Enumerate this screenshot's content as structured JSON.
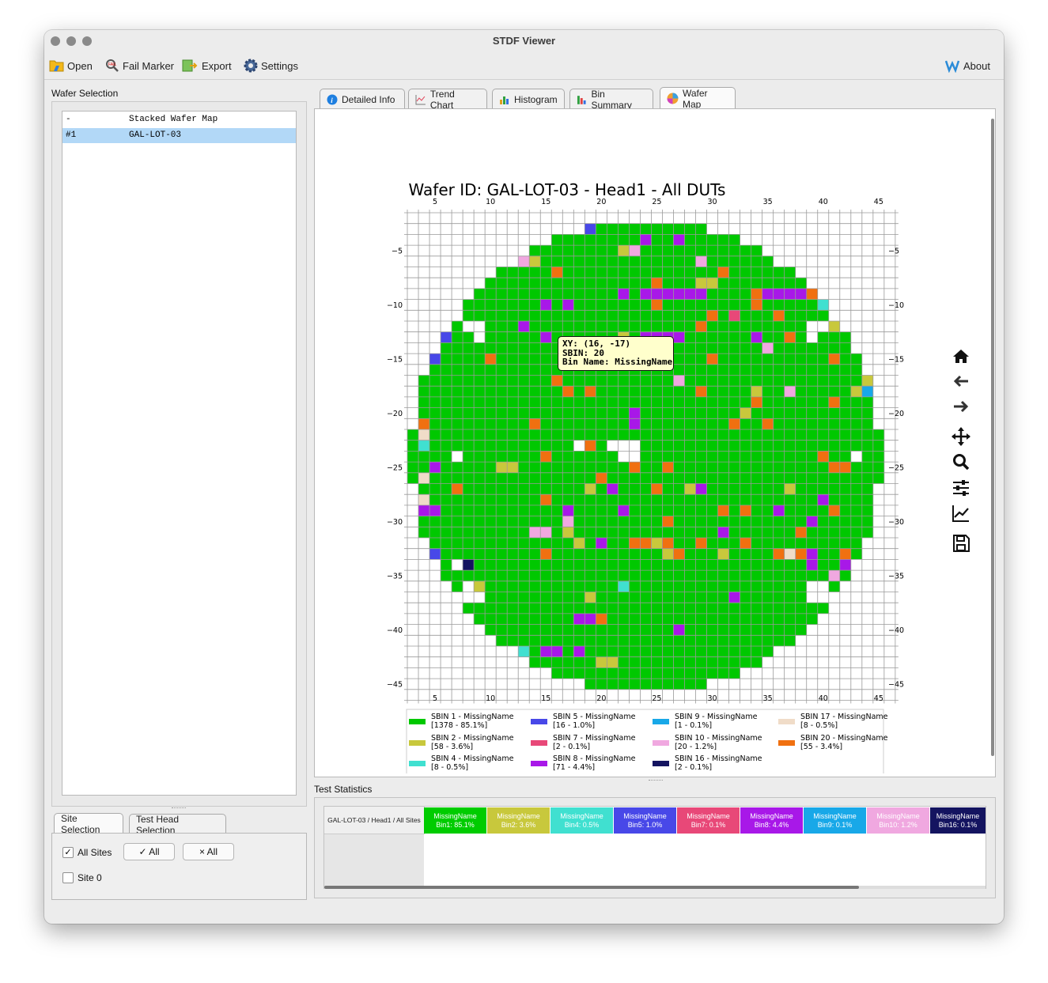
{
  "window": {
    "title": "STDF Viewer"
  },
  "toolbar": {
    "open": "Open",
    "fail_marker": "Fail Marker",
    "export": "Export",
    "settings": "Settings",
    "about": "About"
  },
  "wafer_selection": {
    "title": "Wafer Selection",
    "rows": [
      {
        "id": "-",
        "name": "Stacked Wafer Map"
      },
      {
        "id": "#1",
        "name": "GAL-LOT-03"
      }
    ]
  },
  "bottom_tabs": {
    "site": "Site Selection",
    "head": "Test Head Selection"
  },
  "site_selection": {
    "all_sites": "All Sites",
    "check_all": "✓ All",
    "clear_all": "× All",
    "site0": "Site 0"
  },
  "tabs": [
    "Detailed Info",
    "Trend Chart",
    "Histogram",
    "Bin Summary",
    "Wafer Map"
  ],
  "tooltip": {
    "line1": "XY: (16, -17)",
    "line2": "SBIN: 20",
    "line3": "Bin Name: MissingName"
  },
  "test_statistics": {
    "title": "Test Statistics",
    "row_label": "GAL-LOT-03 / Head1 / All Sites",
    "bins": [
      {
        "name": "MissingName",
        "value": "Bin1: 85.1%",
        "color": "#00cc00"
      },
      {
        "name": "MissingName",
        "value": "Bin2: 3.6%",
        "color": "#c8c83c"
      },
      {
        "name": "MissingName",
        "value": "Bin4: 0.5%",
        "color": "#40e0d0"
      },
      {
        "name": "MissingName",
        "value": "Bin5: 1.0%",
        "color": "#4848e8"
      },
      {
        "name": "MissingName",
        "value": "Bin7: 0.1%",
        "color": "#e84878"
      },
      {
        "name": "MissingName",
        "value": "Bin8: 4.4%",
        "color": "#a818e8"
      },
      {
        "name": "MissingName",
        "value": "Bin9: 0.1%",
        "color": "#18a8e8"
      },
      {
        "name": "MissingName",
        "value": "Bin10: 1.2%",
        "color": "#f0a8e0"
      },
      {
        "name": "MissingName",
        "value": "Bin16: 0.1%",
        "color": "#141460"
      }
    ]
  },
  "chart_data": {
    "type": "heatmap",
    "title": "Wafer ID: GAL-LOT-03 - Head1 - All DUTs",
    "x_ticks": [
      5,
      10,
      15,
      20,
      25,
      30,
      35,
      40,
      45
    ],
    "y_ticks": [
      -5,
      -10,
      -15,
      -20,
      -25,
      -30,
      -35,
      -40,
      -45
    ],
    "xlim": [
      3,
      46
    ],
    "ylim": [
      -46,
      -2
    ],
    "grid": true,
    "center": [
      24,
      -24
    ],
    "radius": 21.2,
    "default_bin": 1,
    "dies": [
      [
        19,
        -3,
        5
      ],
      [
        30,
        -3,
        2
      ],
      [
        24,
        -4,
        8
      ],
      [
        27,
        -4,
        8
      ],
      [
        34,
        -4,
        20
      ],
      [
        35,
        -4,
        2
      ],
      [
        22,
        -5,
        2
      ],
      [
        23,
        -5,
        10
      ],
      [
        13,
        -6,
        10
      ],
      [
        14,
        -6,
        2
      ],
      [
        29,
        -6,
        10
      ],
      [
        16,
        -7,
        20
      ],
      [
        31,
        -7,
        20
      ],
      [
        25,
        -8,
        20
      ],
      [
        29,
        -8,
        2
      ],
      [
        30,
        -8,
        2
      ],
      [
        22,
        -9,
        8
      ],
      [
        24,
        -9,
        8
      ],
      [
        25,
        -9,
        8
      ],
      [
        26,
        -9,
        8
      ],
      [
        27,
        -9,
        8
      ],
      [
        28,
        -9,
        8
      ],
      [
        29,
        -9,
        8
      ],
      [
        34,
        -9,
        20
      ],
      [
        35,
        -9,
        8
      ],
      [
        36,
        -9,
        8
      ],
      [
        37,
        -9,
        8
      ],
      [
        38,
        -9,
        8
      ],
      [
        39,
        -9,
        20
      ],
      [
        15,
        -10,
        8
      ],
      [
        17,
        -10,
        8
      ],
      [
        25,
        -10,
        20
      ],
      [
        34,
        -10,
        20
      ],
      [
        40,
        -10,
        4
      ],
      [
        30,
        -11,
        20
      ],
      [
        32,
        -11,
        7
      ],
      [
        36,
        -11,
        20
      ],
      [
        8,
        -12,
        2
      ],
      [
        13,
        -12,
        8
      ],
      [
        29,
        -12,
        20
      ],
      [
        41,
        -12,
        2
      ],
      [
        6,
        -13,
        5
      ],
      [
        15,
        -13,
        8
      ],
      [
        22,
        -13,
        2
      ],
      [
        24,
        -13,
        8
      ],
      [
        25,
        -13,
        8
      ],
      [
        26,
        -13,
        8
      ],
      [
        27,
        -13,
        8
      ],
      [
        34,
        -13,
        8
      ],
      [
        37,
        -13,
        20
      ],
      [
        43,
        -13,
        5
      ],
      [
        35,
        -14,
        10
      ],
      [
        5,
        -15,
        5
      ],
      [
        10,
        -15,
        20
      ],
      [
        30,
        -15,
        20
      ],
      [
        41,
        -15,
        20
      ],
      [
        44,
        -15,
        5
      ],
      [
        44,
        -16,
        2
      ],
      [
        16,
        -17,
        20
      ],
      [
        27,
        -17,
        10
      ],
      [
        44,
        -17,
        2
      ],
      [
        17,
        -18,
        20
      ],
      [
        19,
        -18,
        20
      ],
      [
        29,
        -18,
        20
      ],
      [
        34,
        -18,
        2
      ],
      [
        37,
        -18,
        10
      ],
      [
        43,
        -18,
        2
      ],
      [
        44,
        -18,
        9
      ],
      [
        34,
        -19,
        20
      ],
      [
        41,
        -19,
        20
      ],
      [
        23,
        -20,
        8
      ],
      [
        33,
        -20,
        2
      ],
      [
        4,
        -21,
        20
      ],
      [
        14,
        -21,
        20
      ],
      [
        23,
        -21,
        8
      ],
      [
        32,
        -21,
        20
      ],
      [
        35,
        -21,
        20
      ],
      [
        4,
        -22,
        17
      ],
      [
        4,
        -23,
        4
      ],
      [
        19,
        -23,
        20
      ],
      [
        15,
        -24,
        20
      ],
      [
        40,
        -24,
        20
      ],
      [
        5,
        -25,
        8
      ],
      [
        11,
        -25,
        2
      ],
      [
        12,
        -25,
        2
      ],
      [
        23,
        -25,
        20
      ],
      [
        26,
        -25,
        20
      ],
      [
        41,
        -25,
        20
      ],
      [
        42,
        -25,
        20
      ],
      [
        4,
        -26,
        17
      ],
      [
        20,
        -26,
        20
      ],
      [
        7,
        -27,
        20
      ],
      [
        19,
        -27,
        2
      ],
      [
        21,
        -27,
        8
      ],
      [
        25,
        -27,
        20
      ],
      [
        28,
        -27,
        2
      ],
      [
        29,
        -27,
        8
      ],
      [
        37,
        -27,
        2
      ],
      [
        15,
        -28,
        20
      ],
      [
        4,
        -28,
        17
      ],
      [
        40,
        -28,
        8
      ],
      [
        4,
        -29,
        8
      ],
      [
        5,
        -29,
        8
      ],
      [
        17,
        -29,
        8
      ],
      [
        22,
        -29,
        8
      ],
      [
        31,
        -29,
        20
      ],
      [
        33,
        -29,
        20
      ],
      [
        36,
        -29,
        8
      ],
      [
        41,
        -29,
        20
      ],
      [
        17,
        -30,
        10
      ],
      [
        26,
        -30,
        20
      ],
      [
        39,
        -30,
        8
      ],
      [
        14,
        -31,
        10
      ],
      [
        15,
        -31,
        10
      ],
      [
        17,
        -31,
        2
      ],
      [
        31,
        -31,
        8
      ],
      [
        38,
        -31,
        20
      ],
      [
        18,
        -32,
        2
      ],
      [
        20,
        -32,
        8
      ],
      [
        23,
        -32,
        20
      ],
      [
        24,
        -32,
        20
      ],
      [
        25,
        -32,
        2
      ],
      [
        26,
        -32,
        20
      ],
      [
        29,
        -32,
        20
      ],
      [
        33,
        -32,
        20
      ],
      [
        5,
        -33,
        5
      ],
      [
        15,
        -33,
        20
      ],
      [
        26,
        -33,
        2
      ],
      [
        27,
        -33,
        20
      ],
      [
        31,
        -33,
        2
      ],
      [
        36,
        -33,
        20
      ],
      [
        37,
        -33,
        17
      ],
      [
        38,
        -33,
        20
      ],
      [
        39,
        -33,
        8
      ],
      [
        42,
        -33,
        20
      ],
      [
        8,
        -34,
        16
      ],
      [
        39,
        -34,
        8
      ],
      [
        42,
        -34,
        8
      ],
      [
        41,
        -35,
        10
      ],
      [
        43,
        -35,
        5
      ],
      [
        9,
        -36,
        2
      ],
      [
        22,
        -36,
        4
      ],
      [
        8,
        -37,
        8
      ],
      [
        19,
        -37,
        2
      ],
      [
        32,
        -37,
        8
      ],
      [
        18,
        -39,
        8
      ],
      [
        19,
        -39,
        8
      ],
      [
        20,
        -39,
        20
      ],
      [
        27,
        -40,
        8
      ],
      [
        13,
        -42,
        4
      ],
      [
        15,
        -42,
        8
      ],
      [
        16,
        -42,
        8
      ],
      [
        18,
        -42,
        8
      ],
      [
        38,
        -42,
        8
      ],
      [
        20,
        -43,
        2
      ],
      [
        21,
        -43,
        2
      ],
      [
        31,
        -45,
        5
      ]
    ],
    "empty": [
      [
        8,
        -12
      ],
      [
        9,
        -12
      ],
      [
        9,
        -13
      ],
      [
        39,
        -12
      ],
      [
        40,
        -12
      ],
      [
        39,
        -13
      ],
      [
        7,
        -24
      ],
      [
        22,
        -23
      ],
      [
        23,
        -23
      ],
      [
        22,
        -24
      ],
      [
        23,
        -24
      ],
      [
        43,
        -24
      ],
      [
        7,
        -34
      ],
      [
        8,
        -36
      ],
      [
        9,
        -37
      ],
      [
        8,
        -37
      ],
      [
        39,
        -36
      ],
      [
        40,
        -36
      ],
      [
        39,
        -37
      ],
      [
        40,
        -37
      ],
      [
        18,
        -23
      ],
      [
        21,
        -23
      ]
    ],
    "legend": [
      {
        "bin": 1,
        "label": "SBIN 1 - MissingName",
        "count": "[1378 - 85.1%]",
        "color": "#00c800"
      },
      {
        "bin": 2,
        "label": "SBIN 2 - MissingName",
        "count": "[58 - 3.6%]",
        "color": "#c8c83c"
      },
      {
        "bin": 4,
        "label": "SBIN 4 - MissingName",
        "count": "[8 - 0.5%]",
        "color": "#40e0d0"
      },
      {
        "bin": 5,
        "label": "SBIN 5 - MissingName",
        "count": "[16 - 1.0%]",
        "color": "#4848e8"
      },
      {
        "bin": 7,
        "label": "SBIN 7 - MissingName",
        "count": "[2 - 0.1%]",
        "color": "#e84878"
      },
      {
        "bin": 8,
        "label": "SBIN 8 - MissingName",
        "count": "[71 - 4.4%]",
        "color": "#a818e8"
      },
      {
        "bin": 9,
        "label": "SBIN 9 - MissingName",
        "count": "[1 - 0.1%]",
        "color": "#18a8e8"
      },
      {
        "bin": 10,
        "label": "SBIN 10 - MissingName",
        "count": "[20 - 1.2%]",
        "color": "#f0a8e0"
      },
      {
        "bin": 16,
        "label": "SBIN 16 - MissingName",
        "count": "[2 - 0.1%]",
        "color": "#141460"
      },
      {
        "bin": 17,
        "label": "SBIN 17 - MissingName",
        "count": "[8 - 0.5%]",
        "color": "#f0dcc8"
      },
      {
        "bin": 20,
        "label": "SBIN 20 - MissingName",
        "count": "[55 - 3.4%]",
        "color": "#f07010"
      }
    ]
  }
}
